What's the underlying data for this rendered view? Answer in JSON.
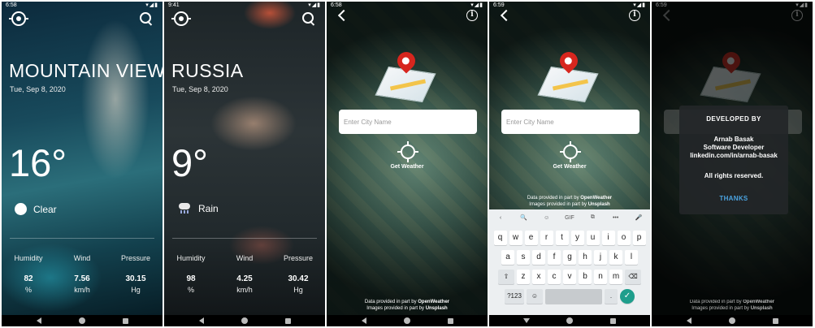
{
  "screens": [
    {
      "status_time": "6:58",
      "city": "MOUNTAIN VIEW",
      "date": "Tue, Sep 8, 2020",
      "temperature": "16°",
      "condition": "Clear",
      "condition_icon": "sun-icon",
      "stats": [
        {
          "label": "Humidity",
          "value": "82",
          "unit": "%"
        },
        {
          "label": "Wind",
          "value": "7.56",
          "unit": "km/h"
        },
        {
          "label": "Pressure",
          "value": "30.15",
          "unit": "Hg"
        }
      ]
    },
    {
      "status_time": "9:41",
      "city": "RUSSIA",
      "date": "Tue, Sep 8, 2020",
      "temperature": "9°",
      "condition": "Rain",
      "condition_icon": "rain-icon",
      "stats": [
        {
          "label": "Humidity",
          "value": "98",
          "unit": "%"
        },
        {
          "label": "Wind",
          "value": "4.25",
          "unit": "km/h"
        },
        {
          "label": "Pressure",
          "value": "30.42",
          "unit": "Hg"
        }
      ]
    },
    {
      "status_time": "6:58",
      "input_placeholder": "Enter City Name",
      "get_weather_label": "Get Weather",
      "credit_data_prefix": "Data provided in part by",
      "credit_data_source": "OpenWeather",
      "credit_images_prefix": "Images provided in part by",
      "credit_images_source": "Unsplash"
    },
    {
      "status_time": "6:59",
      "input_placeholder": "Enter City Name",
      "get_weather_label": "Get Weather",
      "credit_data_prefix": "Data provided in part by",
      "credit_data_source": "OpenWeather",
      "credit_images_prefix": "Images provided in part by",
      "credit_images_source": "Unsplash",
      "keyboard": {
        "toolbar": [
          "‹",
          "🔍",
          "☺",
          "GIF",
          "⧉",
          "•••",
          "🎤"
        ],
        "row1": [
          "q",
          "w",
          "e",
          "r",
          "t",
          "y",
          "u",
          "i",
          "o",
          "p"
        ],
        "row1_hints": [
          "1",
          "2",
          "3",
          "4",
          "5",
          "6",
          "7",
          "8",
          "9",
          "0"
        ],
        "row2": [
          "a",
          "s",
          "d",
          "f",
          "g",
          "h",
          "j",
          "k",
          "l"
        ],
        "row3": [
          "z",
          "x",
          "c",
          "v",
          "b",
          "n",
          "m"
        ],
        "shift": "⇧",
        "backspace": "⌫",
        "symbols": "?123",
        "emoji": "☺",
        "enter": "✓"
      }
    },
    {
      "status_time": "6:59",
      "dialog_title": "DEVELOPED BY",
      "dialog_name": "Arnab Basak",
      "dialog_role": "Software Developer",
      "dialog_link": "linkedin.com/in/arnab-basak",
      "dialog_rights": "All rights reserved.",
      "dialog_button": "THANKS",
      "credit_data_prefix": "Data provided in part by",
      "credit_data_source": "OpenWeather",
      "credit_images_prefix": "Images provided in part by",
      "credit_images_source": "Unsplash"
    }
  ]
}
